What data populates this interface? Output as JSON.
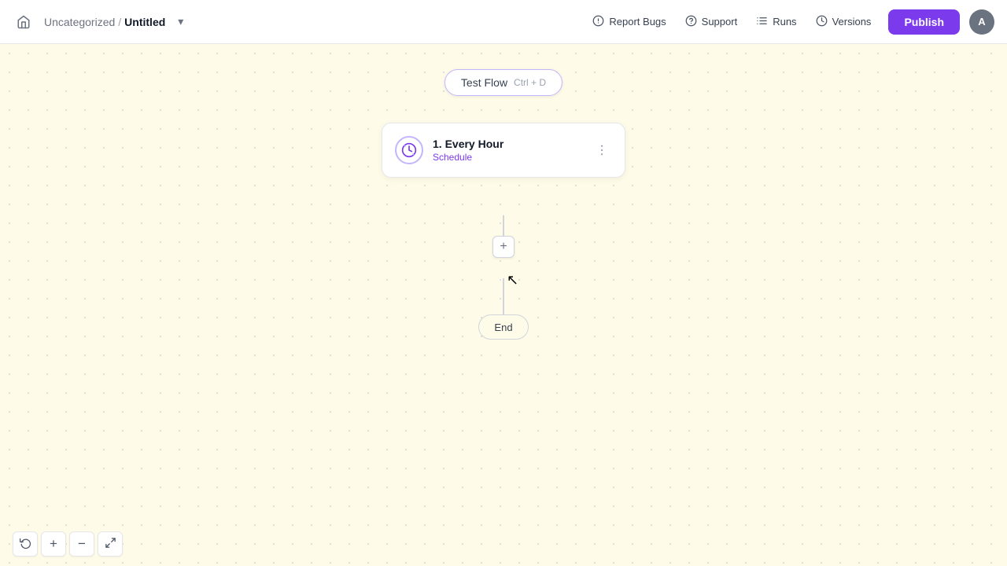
{
  "header": {
    "home_icon": "🏠",
    "breadcrumb": {
      "parent": "Uncategorized",
      "separator": "/",
      "current": "Untitled"
    },
    "chevron_icon": "▾",
    "nav": {
      "report_bugs_icon": "⚙",
      "report_bugs": "Report Bugs",
      "support_icon": "?",
      "support": "Support",
      "runs_icon": "☰",
      "runs": "Runs",
      "versions_icon": "🕐",
      "versions": "Versions",
      "publish": "Publish",
      "avatar": "A"
    }
  },
  "canvas": {
    "test_flow": {
      "label": "Test Flow",
      "shortcut": "Ctrl + D"
    },
    "node": {
      "title": "1. Every Hour",
      "subtitle": "Schedule"
    },
    "end_label": "End"
  },
  "toolbar": {
    "refresh_icon": "↺",
    "zoom_in_icon": "+",
    "zoom_out_icon": "−",
    "fit_icon": "⊞"
  }
}
